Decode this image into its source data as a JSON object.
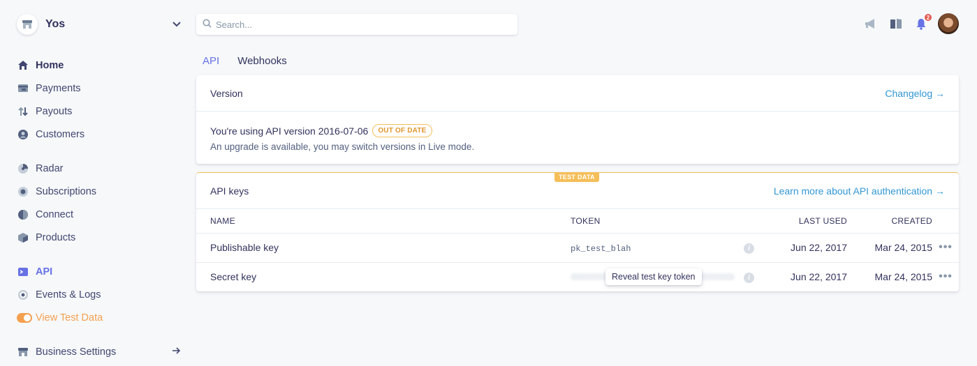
{
  "account": {
    "name": "Yos",
    "logo_icon": "store-icon"
  },
  "nav": {
    "items": [
      {
        "label": "Home",
        "icon": "home-icon"
      },
      {
        "label": "Payments",
        "icon": "payments-icon"
      },
      {
        "label": "Payouts",
        "icon": "payouts-icon"
      },
      {
        "label": "Customers",
        "icon": "customers-icon"
      },
      {
        "label": "Radar",
        "icon": "radar-icon"
      },
      {
        "label": "Subscriptions",
        "icon": "subscriptions-icon"
      },
      {
        "label": "Connect",
        "icon": "connect-icon"
      },
      {
        "label": "Products",
        "icon": "products-icon"
      },
      {
        "label": "API",
        "icon": "api-icon"
      },
      {
        "label": "Events & Logs",
        "icon": "events-icon"
      },
      {
        "label": "View Test Data",
        "icon": "toggle-icon"
      },
      {
        "label": "Business Settings",
        "icon": "settings-icon"
      }
    ]
  },
  "search": {
    "placeholder": "Search..."
  },
  "topbar": {
    "notifications_count": "2"
  },
  "tabs": [
    {
      "label": "API"
    },
    {
      "label": "Webhooks"
    }
  ],
  "version_card": {
    "title": "Version",
    "link": "Changelog →",
    "version_text": "You're using API version 2016-07-06",
    "status_badge": "OUT OF DATE",
    "subtext": "An upgrade is available, you may switch versions in Live mode."
  },
  "keys_card": {
    "test_tag": "TEST DATA",
    "title": "API keys",
    "link": "Learn more about API authentication →",
    "columns": {
      "name": "NAME",
      "token": "TOKEN",
      "last_used": "LAST USED",
      "created": "CREATED"
    },
    "rows": [
      {
        "name": "Publishable key",
        "token": "pk_test_blah",
        "last_used": "Jun 22, 2017",
        "created": "Mar 24, 2015"
      },
      {
        "name": "Secret key",
        "token": "",
        "last_used": "Jun 22, 2017",
        "created": "Mar 24, 2015"
      }
    ],
    "tooltip": "Reveal test key token",
    "more_label": "•••"
  },
  "colors": {
    "accent": "#6772e5",
    "test_orange": "#f5a04f",
    "link_blue": "#3297d3"
  }
}
